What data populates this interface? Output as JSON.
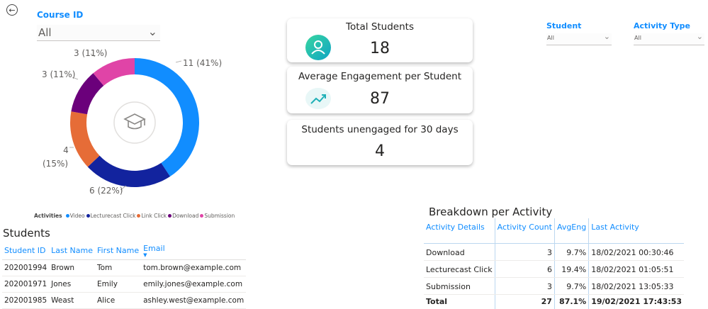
{
  "nav": {
    "back_icon": "arrow-left-circle-icon"
  },
  "filters": {
    "course": {
      "label": "Course ID",
      "value": "All"
    },
    "student": {
      "label": "Student",
      "value": "All"
    },
    "activity_type": {
      "label": "Activity Type",
      "value": "All"
    }
  },
  "kpis": {
    "total_students": {
      "title": "Total Students",
      "value": "18",
      "icon": "person-icon"
    },
    "avg_engagement": {
      "title": "Average Engagement per Student",
      "value": "87",
      "icon": "trend-up-icon"
    },
    "unengaged": {
      "title": "Students unengaged for 30 days",
      "value": "4"
    }
  },
  "chart_data": {
    "type": "pie",
    "center_icon": "graduation-cap-icon",
    "legend_title": "Activities",
    "legend_position": "bottom",
    "categories": [
      "Video",
      "Lecturecast Click",
      "Link Click",
      "Download",
      "Submission"
    ],
    "values": [
      11,
      6,
      4,
      3,
      3
    ],
    "labels": [
      "11 (41%)",
      "6 (22%)",
      "4 (15%)",
      "3 (11%)",
      "3 (11%)"
    ],
    "colors": [
      "#118dff",
      "#12239e",
      "#e66c37",
      "#6b007b",
      "#e044a7"
    ]
  },
  "students": {
    "title": "Students",
    "columns": [
      "Student ID",
      "Last Name",
      "First Name",
      "Email"
    ],
    "rows": [
      [
        "202001994",
        "Brown",
        "Tom",
        "tom.brown@example.com"
      ],
      [
        "202001971",
        "Jones",
        "Emily",
        "emily.jones@example.com"
      ],
      [
        "202001985",
        "Weast",
        "Alice",
        "ashley.west@example.com"
      ]
    ]
  },
  "breakdown": {
    "title": "Breakdown per Activity",
    "columns": [
      "Activity Details",
      "Activity Count",
      "AvgEng",
      "Last Activity"
    ],
    "rows": [
      [
        "Download",
        "3",
        "9.7%",
        "18/02/2021 00:30:46"
      ],
      [
        "Lecturecast Click",
        "6",
        "19.4%",
        "18/02/2021 01:05:51"
      ],
      [
        "Submission",
        "3",
        "9.7%",
        "18/02/2021 13:05:33"
      ]
    ],
    "total": [
      "Total",
      "27",
      "87.1%",
      "19/02/2021 17:43:53"
    ]
  }
}
